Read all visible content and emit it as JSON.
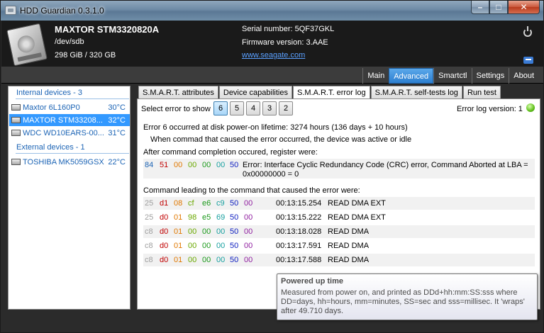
{
  "window": {
    "title": "HDD Guardian 0.3.1.0",
    "min": "–",
    "max": "□",
    "close": "✕"
  },
  "header": {
    "model": "MAXTOR STM3320820A",
    "path": "/dev/sdb",
    "size": "298 GiB / 320 GB",
    "serial": "Serial number: 5QF37GKL",
    "firmware": "Firmware version: 3.AAE",
    "website": "www.seagate.com",
    "icons": [
      "drive-icon",
      "power-icon",
      "chat-icon"
    ]
  },
  "nav": {
    "tabs": [
      "Main",
      "Advanced",
      "Smartctl",
      "Settings",
      "About"
    ],
    "active": "Advanced",
    "accent": "#3a8ee0"
  },
  "sidebar": {
    "internal_title": "Internal devices - 3",
    "internal": [
      {
        "name": "Maxtor 6L160P0",
        "temp": "30°C",
        "selected": false
      },
      {
        "name": "MAXTOR STM33208...",
        "temp": "32°C",
        "selected": true
      },
      {
        "name": "WDC WD10EARS-00...",
        "temp": "31°C",
        "selected": false
      }
    ],
    "external_title": "External devices - 1",
    "external": [
      {
        "name": "TOSHIBA MK5059GSXP",
        "temp": "22°C",
        "selected": false
      }
    ]
  },
  "tabs": [
    "S.M.A.R.T. attributes",
    "Device capabilities",
    "S.M.A.R.T. error log",
    "S.M.A.R.T. self-tests log",
    "Run test"
  ],
  "active_tab": "S.M.A.R.T. error log",
  "errorlog": {
    "select_label": "Select error to show",
    "buttons": [
      "6",
      "5",
      "4",
      "3",
      "2"
    ],
    "selected": "6",
    "version": "Error log version: 1",
    "occurred": "Error 6 occurred at disk power-on lifetime: 3274 hours (136 days + 10 hours)",
    "state": "When commad that caused the error occurred, the device was active or idle",
    "after_label": "After command completion occured, register were:",
    "registers": [
      "84",
      "51",
      "00",
      "00",
      "00",
      "00",
      "50"
    ],
    "register_desc": "Error: Interface Cyclic Redundancy Code (CRC) error, Command Aborted at LBA = 0x00000000 = 0",
    "cmd_label": "Command leading to the command that caused the error were:",
    "commands": [
      {
        "regs": [
          "25",
          "d1",
          "08",
          "cf",
          "e6",
          "c9",
          "50",
          "00"
        ],
        "time": "00:13:15.254",
        "cmd": "READ DMA EXT"
      },
      {
        "regs": [
          "25",
          "d0",
          "01",
          "98",
          "e5",
          "69",
          "50",
          "00"
        ],
        "time": "00:13:15.222",
        "cmd": "READ DMA EXT"
      },
      {
        "regs": [
          "c8",
          "d0",
          "01",
          "00",
          "00",
          "00",
          "50",
          "00"
        ],
        "time": "00:13:18.028",
        "cmd": "READ DMA"
      },
      {
        "regs": [
          "c8",
          "d0",
          "01",
          "00",
          "00",
          "00",
          "50",
          "00"
        ],
        "time": "00:13:17.591",
        "cmd": "READ DMA"
      },
      {
        "regs": [
          "c8",
          "d0",
          "01",
          "00",
          "00",
          "00",
          "50",
          "00"
        ],
        "time": "00:13:17.588",
        "cmd": "READ DMA"
      }
    ],
    "reg_colors": [
      "#a0a0a0",
      "#c00000",
      "#e07800",
      "#6aa800",
      "#1c9a1c",
      "#18a0a0",
      "#1020c0",
      "#9020a0"
    ]
  },
  "tooltip": {
    "title": "Powered up time",
    "body": "Measured from power on, and printed as DDd+hh:mm:SS:sss where DD=days, hh=hours, mm=minutes, SS=sec and sss=millisec. It 'wraps' after 49.710 days."
  }
}
